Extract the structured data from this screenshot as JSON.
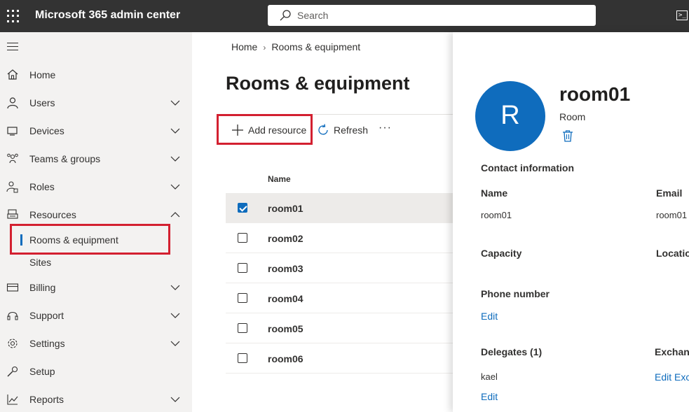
{
  "topbar": {
    "app_title": "Microsoft 365 admin center",
    "search_placeholder": "Search"
  },
  "nav": {
    "items": [
      {
        "label": "Home",
        "icon": "home-icon"
      },
      {
        "label": "Users",
        "icon": "user-icon"
      },
      {
        "label": "Devices",
        "icon": "devices-icon"
      },
      {
        "label": "Teams & groups",
        "icon": "people-icon"
      },
      {
        "label": "Roles",
        "icon": "roles-icon"
      },
      {
        "label": "Resources",
        "icon": "resources-icon"
      },
      {
        "label": "Billing",
        "icon": "billing-icon"
      },
      {
        "label": "Support",
        "icon": "headset-icon"
      },
      {
        "label": "Settings",
        "icon": "gear-icon"
      },
      {
        "label": "Setup",
        "icon": "wrench-icon"
      },
      {
        "label": "Reports",
        "icon": "chart-icon"
      }
    ],
    "sub_items": [
      {
        "label": "Rooms & equipment"
      },
      {
        "label": "Sites"
      }
    ]
  },
  "breadcrumb": [
    "Home",
    "Rooms & equipment"
  ],
  "page_title": "Rooms & equipment",
  "commands": {
    "add": "Add resource",
    "refresh": "Refresh",
    "more": "···"
  },
  "table": {
    "column_header": "Name",
    "rows": [
      {
        "name": "room01",
        "checked": true
      },
      {
        "name": "room02",
        "checked": false
      },
      {
        "name": "room03",
        "checked": false
      },
      {
        "name": "room04",
        "checked": false
      },
      {
        "name": "room05",
        "checked": false
      },
      {
        "name": "room06",
        "checked": false
      }
    ]
  },
  "panel": {
    "avatar_letter": "R",
    "title": "room01",
    "subtitle": "Room",
    "contact_section": "Contact information",
    "name_label": "Name",
    "name_value": "room01",
    "email_label": "Email",
    "email_value": "room01",
    "capacity_label": "Capacity",
    "location_label": "Locatio",
    "phone_label": "Phone number",
    "phone_edit": "Edit",
    "delegates_label": "Delegates (1)",
    "delegates_value": "kael",
    "delegates_edit": "Edit",
    "exchange_label": "Exchang",
    "exchange_edit": "Edit Exch"
  },
  "colors": {
    "accent": "#0f6cbd",
    "topbar": "#333333",
    "highlight": "#d32030"
  }
}
